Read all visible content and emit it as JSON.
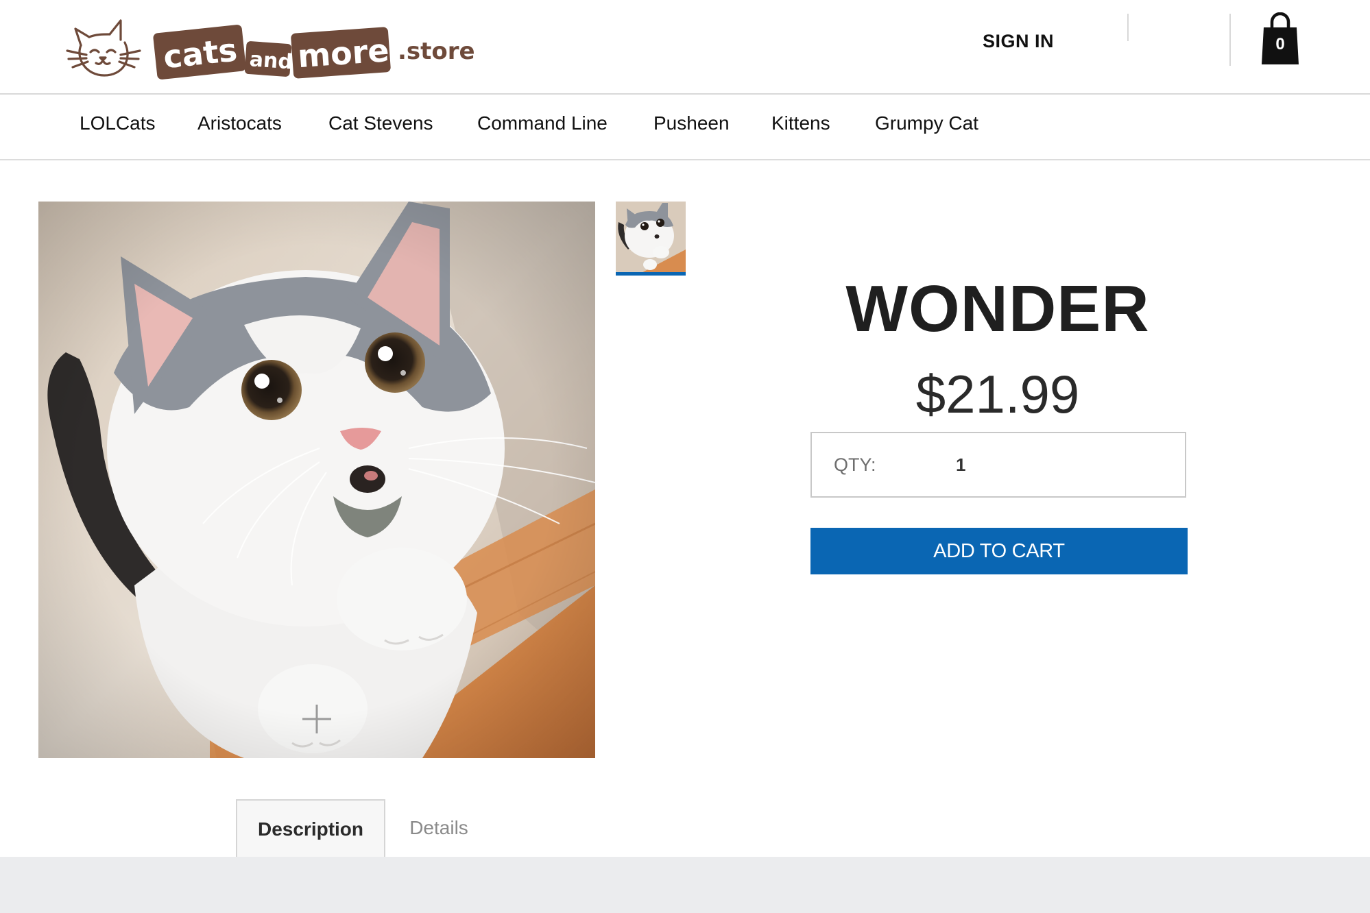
{
  "header": {
    "logo": {
      "word_cats": "cats",
      "word_and": "and",
      "word_more": "more",
      "suffix": ".store",
      "brand_color": "#6e4a3a",
      "icon": "cat-face-icon"
    },
    "sign_in_label": "SIGN IN",
    "cart": {
      "icon": "shopping-bag-icon",
      "count": "0"
    }
  },
  "nav": {
    "items": [
      {
        "label": "LOLCats"
      },
      {
        "label": "Aristocats"
      },
      {
        "label": "Cat Stevens"
      },
      {
        "label": "Command Line"
      },
      {
        "label": "Pusheen"
      },
      {
        "label": "Kittens"
      },
      {
        "label": "Grumpy Cat"
      }
    ]
  },
  "gallery": {
    "main_image": "kitten-photo",
    "zoom_icon": "plus-icon",
    "thumbnail_selected_color": "#0a66b3"
  },
  "product": {
    "title": "WONDER",
    "price": "$21.99",
    "qty_label": "QTY:",
    "qty_value": "1",
    "add_to_cart_label": "ADD TO CART",
    "button_color": "#0a66b3"
  },
  "tabs": [
    {
      "label": "Description",
      "active": true
    },
    {
      "label": "Details",
      "active": false
    }
  ]
}
